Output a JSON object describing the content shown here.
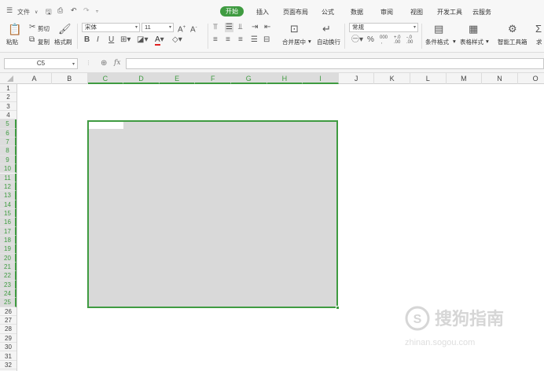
{
  "toolbar": {
    "menu_label": "文件",
    "tabs": [
      "开始",
      "插入",
      "页面布局",
      "公式",
      "数据",
      "审阅",
      "视图",
      "开发工具",
      "云服务"
    ],
    "active_tab": "开始"
  },
  "ribbon": {
    "paste": "粘贴",
    "cut": "剪切",
    "copy": "复制",
    "format_painter": "格式刷",
    "font_name": "宋体",
    "font_size": "11",
    "merge_center": "合并居中",
    "wrap_text": "自动换行",
    "number_format": "常规",
    "conditional_format": "条件格式",
    "table_style": "表格样式",
    "smart_toolbox": "智能工具箱",
    "sum_partial": "求"
  },
  "formula_bar": {
    "name_box": "C5",
    "fx_label": "fx",
    "formula": ""
  },
  "grid": {
    "columns": [
      "A",
      "B",
      "C",
      "D",
      "E",
      "F",
      "G",
      "H",
      "I",
      "J",
      "K",
      "L",
      "M",
      "N",
      "O"
    ],
    "selected_columns": [
      "C",
      "D",
      "E",
      "F",
      "G",
      "H",
      "I"
    ],
    "rows": [
      "1",
      "2",
      "3",
      "4",
      "5",
      "6",
      "7",
      "8",
      "9",
      "10",
      "11",
      "12",
      "13",
      "14",
      "15",
      "16",
      "17",
      "18",
      "19",
      "20",
      "21",
      "22",
      "23",
      "24",
      "25",
      "26",
      "27",
      "28",
      "29",
      "30",
      "31",
      "32"
    ],
    "selected_row_range": [
      5,
      25
    ],
    "active_cell": "C5",
    "selection": "C5:I25"
  },
  "colors": {
    "accent": "#3f9b41",
    "selection_fill": "#d9d9d9"
  },
  "watermark": {
    "text_cn": "搜狗指南",
    "text_en": "zhinan.sogou.com"
  }
}
